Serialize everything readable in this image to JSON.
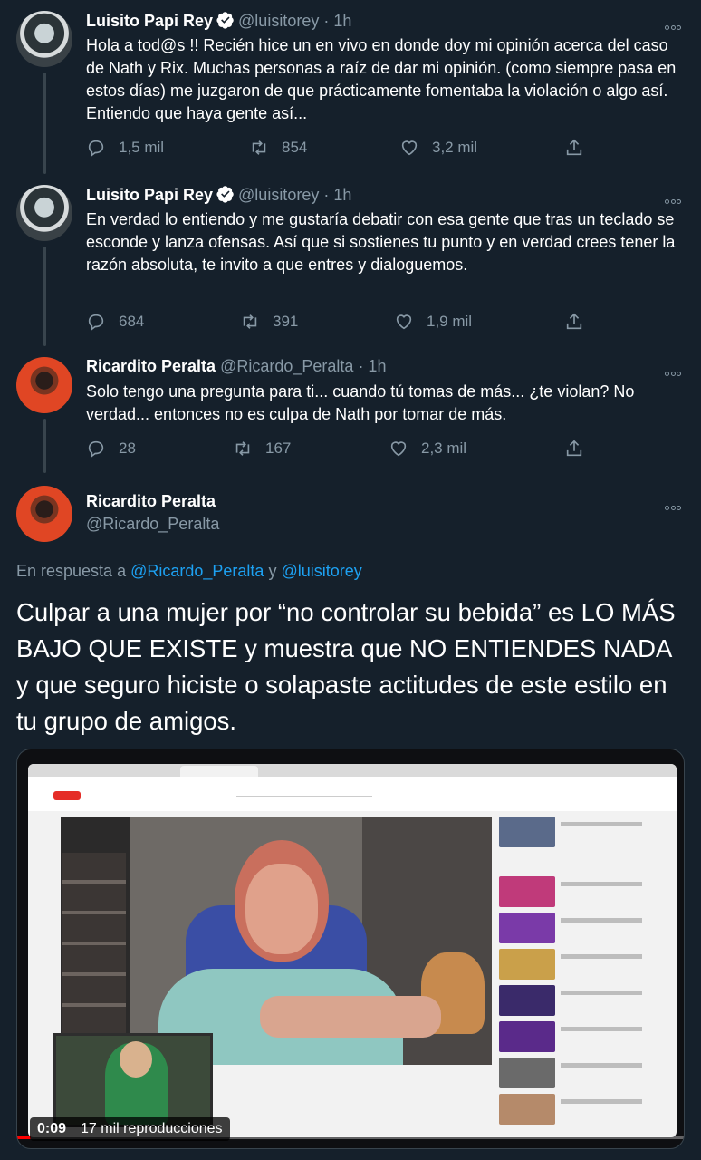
{
  "tweets": [
    {
      "name": "Luisito Papi Rey",
      "handle": "@luisitorey",
      "time": "· 1h",
      "text": "Hola a tod@s !! Recién hice un en vivo en donde doy mi opinión acerca del caso de Nath y Rix. Muchas personas a raíz de dar mi opinión. (como siempre pasa en estos días) me juzgaron de que prácticamente fomentaba la violación o algo así. Entiendo que haya gente así...",
      "replies": "1,5 mil",
      "retweets": "854",
      "likes": "3,2 mil",
      "verified": true
    },
    {
      "name": "Luisito Papi Rey",
      "handle": "@luisitorey",
      "time": "· 1h",
      "text": "En verdad lo entiendo y me gustaría debatir con esa gente que tras un teclado se esconde y lanza ofensas. Así que si sostienes tu punto y en verdad crees tener la razón absoluta, te invito a que entres y dialoguemos.",
      "replies": "684",
      "retweets": "391",
      "likes": "1,9 mil",
      "verified": true
    },
    {
      "name": "Ricardito Peralta",
      "handle": "@Ricardo_Peralta",
      "time": "· 1h",
      "text": "Solo tengo una pregunta para ti... cuando tú tomas de más... ¿te violan? No verdad... entonces no es culpa de Nath por tomar de más.",
      "replies": "28",
      "retweets": "167",
      "likes": "2,3 mil",
      "verified": false
    }
  ],
  "main_tweet": {
    "name": "Ricardito Peralta",
    "handle": "@Ricardo_Peralta",
    "reply_prefix": "En respuesta a",
    "reply_user1": "@Ricardo_Peralta",
    "reply_and": "y",
    "reply_user2": "@luisitorey",
    "text": "Culpar a una mujer por “no controlar su bebida” es LO MÁS BAJO QUE EXISTE y muestra que NO ENTIENDES NADA y que seguro hiciste o solapaste actitudes de este estilo en tu grupo de amigos.",
    "video_duration": "0:09",
    "video_views": "17 mil reproducciones",
    "video_progress": 0.02
  },
  "colors": {
    "background": "#15202b",
    "secondary_text": "#8899a6",
    "link": "#1da1f2",
    "divider": "#38444d"
  },
  "icons": [
    "verified-badge-icon",
    "more-options-icon",
    "reply-icon",
    "retweet-icon",
    "like-icon",
    "share-icon"
  ]
}
